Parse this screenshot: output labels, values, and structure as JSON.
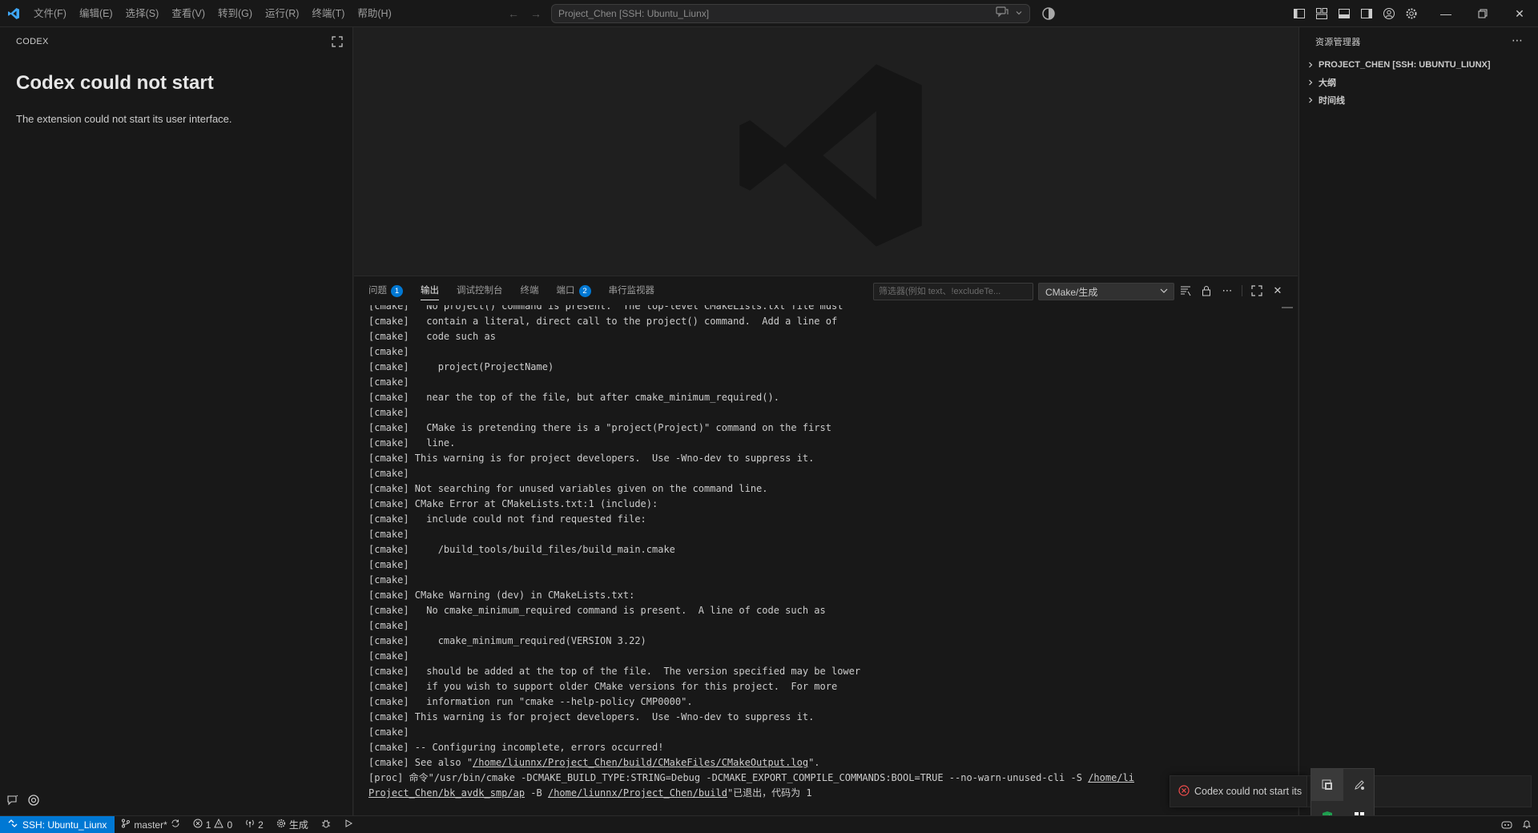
{
  "titlebar": {
    "menus": [
      "文件(F)",
      "编辑(E)",
      "选择(S)",
      "查看(V)",
      "转到(G)",
      "运行(R)",
      "终端(T)",
      "帮助(H)"
    ],
    "command_center": "Project_Chen [SSH: Ubuntu_Liunx]"
  },
  "left_panel": {
    "header": "CODEX",
    "title": "Codex could not start",
    "message": "The extension could not start its user interface."
  },
  "panel": {
    "tabs": [
      {
        "label": "问题",
        "badge": "1"
      },
      {
        "label": "输出",
        "badge": ""
      },
      {
        "label": "调试控制台",
        "badge": ""
      },
      {
        "label": "终端",
        "badge": ""
      },
      {
        "label": "端口",
        "badge": "2"
      },
      {
        "label": "串行监视器",
        "badge": ""
      }
    ],
    "active_tab": "输出",
    "filter_placeholder": "筛选器(例如 text、!excludeTe...",
    "channel": "CMake/生成",
    "output_lines": [
      "[cmake]   No project() command is present.  The top-level CMakeLists.txt file must",
      "[cmake]   contain a literal, direct call to the project() command.  Add a line of",
      "[cmake]   code such as",
      "[cmake]",
      "[cmake]     project(ProjectName)",
      "[cmake]",
      "[cmake]   near the top of the file, but after cmake_minimum_required().",
      "[cmake]",
      "[cmake]   CMake is pretending there is a \"project(Project)\" command on the first",
      "[cmake]   line.",
      "[cmake] This warning is for project developers.  Use -Wno-dev to suppress it.",
      "[cmake]",
      "[cmake] Not searching for unused variables given on the command line.",
      "[cmake] CMake Error at CMakeLists.txt:1 (include):",
      "[cmake]   include could not find requested file:",
      "[cmake]",
      "[cmake]     /build_tools/build_files/build_main.cmake",
      "[cmake]",
      "[cmake]",
      "[cmake] CMake Warning (dev) in CMakeLists.txt:",
      "[cmake]   No cmake_minimum_required command is present.  A line of code such as",
      "[cmake]",
      "[cmake]     cmake_minimum_required(VERSION 3.22)",
      "[cmake]",
      "[cmake]   should be added at the top of the file.  The version specified may be lower",
      "[cmake]   if you wish to support older CMake versions for this project.  For more",
      "[cmake]   information run \"cmake --help-policy CMP0000\".",
      "[cmake] This warning is for project developers.  Use -Wno-dev to suppress it.",
      "[cmake]",
      "[cmake] -- Configuring incomplete, errors occurred!"
    ],
    "see_also_prefix": "[cmake] See also \"",
    "see_also_link": "/home/liunnx/Project_Chen/build/CMakeFiles/CMakeOutput.log",
    "see_also_suffix": "\".",
    "proc_prefix": "[proc] 命令\"/usr/bin/cmake -DCMAKE_BUILD_TYPE:STRING=Debug -DCMAKE_EXPORT_COMPILE_COMMANDS:BOOL=TRUE --no-warn-unused-cli -S ",
    "proc_link1": "/home/li",
    "proc_link2": "Project_Chen/bk_avdk_smp/ap",
    "proc_mid": " -B ",
    "proc_link3": "/home/liunnx/Project_Chen/build",
    "proc_suffix": "\"已退出，代码为 1"
  },
  "right_panel": {
    "header": "资源管理器",
    "items": [
      "PROJECT_CHEN [SSH: UBUNTU_LIUNX]",
      "大纲",
      "时间线"
    ]
  },
  "statusbar": {
    "remote": "SSH: Ubuntu_Liunx",
    "branch": "master*",
    "errors": "1",
    "warnings": "0",
    "ports": "2",
    "build": "生成"
  },
  "notification": {
    "text": "Codex could not start its"
  },
  "colors": {
    "accent": "#0078d4",
    "error": "#f14c4c",
    "background": "#1f1f1f",
    "sidebar": "#181818"
  }
}
